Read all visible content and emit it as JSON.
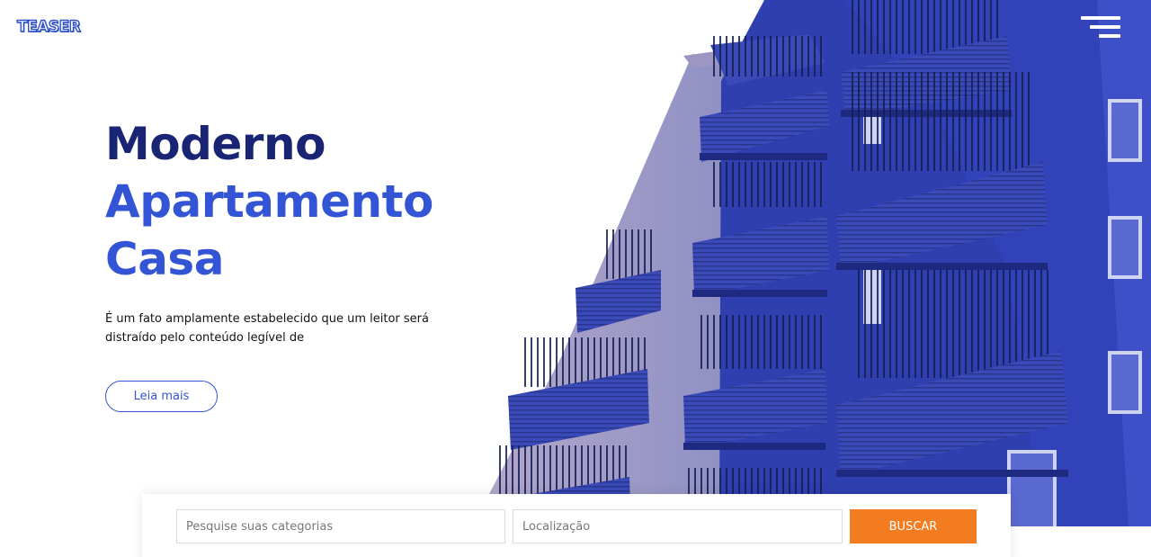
{
  "header": {
    "logo": "TEASER",
    "menu_icon": "hamburger-menu-icon"
  },
  "hero": {
    "headline_line1": "Moderno",
    "headline_line2": "Apartamento",
    "headline_line3": "Casa",
    "description": "É um fato amplamente estabelecido que um leitor será distraído pelo conteúdo legível de",
    "read_more_label": "Leia mais",
    "colors": {
      "headline_dark": "#1a2474",
      "headline_accent": "#3354d4",
      "building_blue": "#2f3fb0",
      "building_side": "#a8a3c9"
    }
  },
  "search": {
    "category_placeholder": "Pesquise suas categorias",
    "location_placeholder": "Localização",
    "button_label": "BUSCAR",
    "button_color": "#f47c20"
  }
}
